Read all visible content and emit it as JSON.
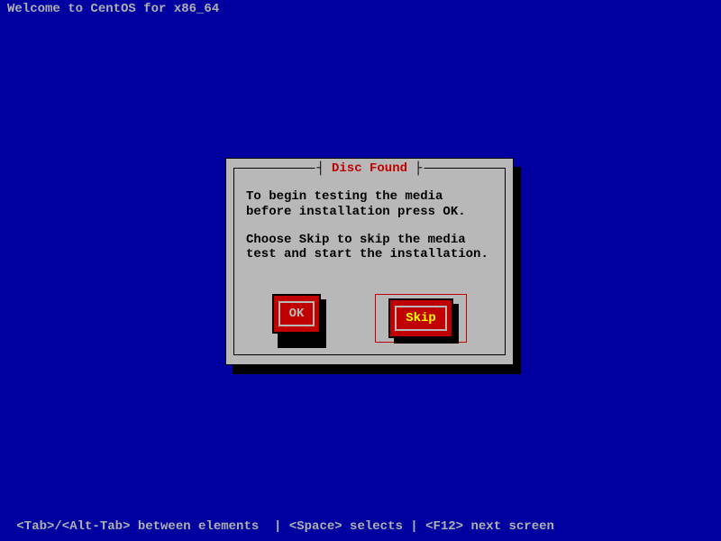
{
  "header": "Welcome to CentOS for x86_64",
  "dialog": {
    "title": "Disc Found",
    "body_line1": "To begin testing the media before installation press OK.",
    "body_line2": "Choose Skip to skip the media test and start the installation.",
    "ok_label": "OK",
    "skip_label": "Skip"
  },
  "footer": " <Tab>/<Alt-Tab> between elements  | <Space> selects | <F12> next screen "
}
